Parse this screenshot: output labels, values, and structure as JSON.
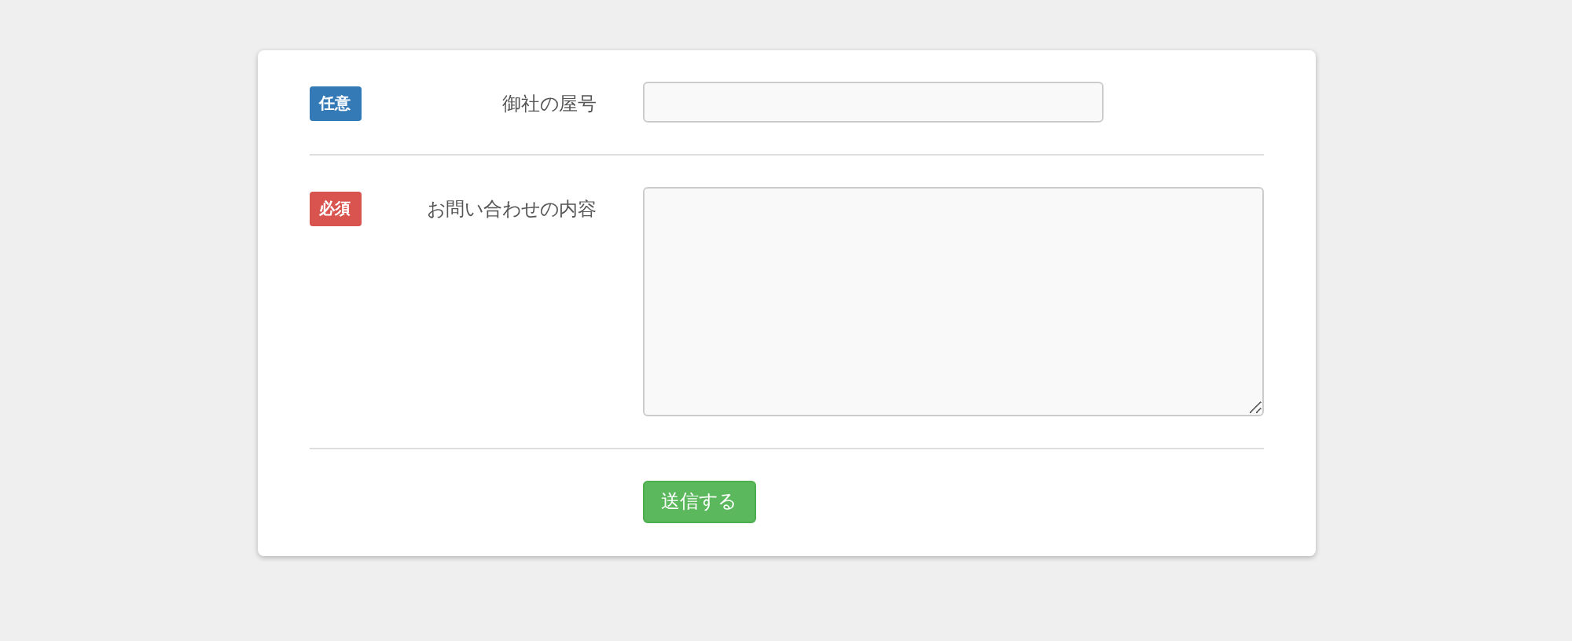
{
  "form": {
    "fields": [
      {
        "badge": {
          "label": "任意",
          "kind": "optional"
        },
        "label": "御社の屋号",
        "kind": "text"
      },
      {
        "badge": {
          "label": "必須",
          "kind": "required"
        },
        "label": "お問い合わせの内容",
        "kind": "textarea"
      }
    ],
    "submit_button": "送信する"
  }
}
